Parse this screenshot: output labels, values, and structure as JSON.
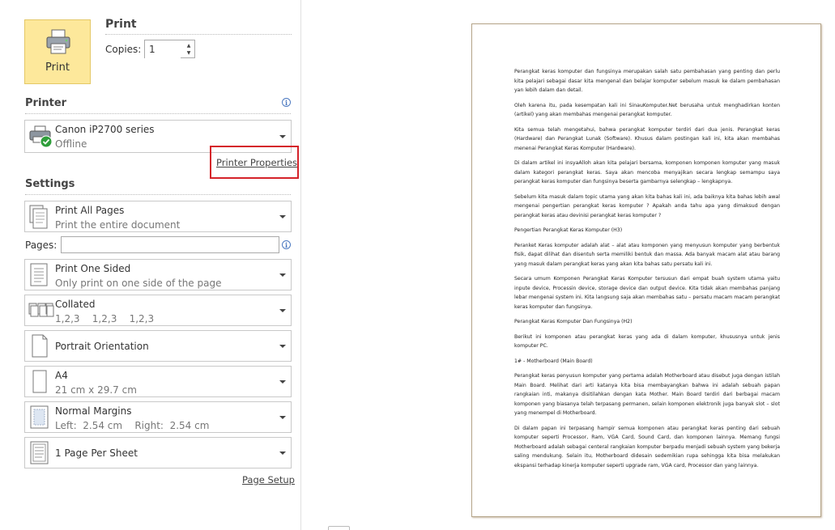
{
  "print": {
    "button_label": "Print",
    "title": "Print",
    "copies_label": "Copies:",
    "copies_value": "1"
  },
  "printer": {
    "heading": "Printer",
    "name": "Canon iP2700 series",
    "status": "Offline",
    "properties_link": "Printer Properties"
  },
  "settings": {
    "heading": "Settings",
    "pages_label": "Pages:",
    "pages_value": "",
    "items": [
      {
        "title": "Print All Pages",
        "subtitle": "Print the entire document",
        "icon": "pages-icon"
      },
      {
        "title": "Print One Sided",
        "subtitle": "Only print on one side of the page",
        "icon": "one-sided-icon"
      },
      {
        "title": "Collated",
        "subtitle": "1,2,3    1,2,3    1,2,3",
        "icon": "collated-icon"
      },
      {
        "title": "Portrait Orientation",
        "subtitle": "",
        "icon": "portrait-icon"
      },
      {
        "title": "A4",
        "subtitle": "21 cm x 29.7 cm",
        "icon": "paper-size-icon"
      },
      {
        "title": "Normal Margins",
        "subtitle": "Left:  2.54 cm    Right:  2.54 cm",
        "icon": "margins-icon"
      },
      {
        "title": "1 Page Per Sheet",
        "subtitle": "",
        "icon": "pages-per-sheet-icon"
      }
    ],
    "page_setup_link": "Page Setup"
  },
  "preview": {
    "paragraphs": [
      "Perangkat keras komputer dan fungsinya merupakan salah satu pembahasan yang penting dan perlu kita pelajari sebagai dasar kita mengenal dan belajar komputer sebelum masuk ke dalam pembahasan yan lebih dalam dan detail.",
      "Oleh karena itu, pada kesempatan kali ini SinauKomputer.Net berusaha untuk menghadirkan konten (artikel) yang akan membahas mengenai perangkat komputer.",
      "Kita semua telah mengetahui, bahwa perangkat komputer terdiri dari dua jenis. Perangkat keras (Hardware) dan Perangkat Lunak (Software). Khusus dalam postingan kali ini, kita akan membahas menenai Perangkat Keras Komputer (Hardware).",
      "Di dalam artikel ini insyaAlloh akan kita pelajari bersama, komponen komponen komputer yang masuk dalam kategori perangkat keras. Saya akan mencoba menyajikan secara lengkap semampu saya perangkat keras komputer dan fungsinya beserta gambarnya selengkap – lengkapnya.",
      "Sebelum kita masuk dalam topic utama yang akan kita bahas kali ini, ada baiknya kita bahas lebih awal mengenai pengertian perangkat keras komputer ? Apakah anda tahu apa yang dimaksud dengan perangkat keras atau devinisi perangkat keras komputer ?",
      "Pengertian Perangkat Keras Komputer (H3)",
      "Peranket Keras komputer adalah alat – alat atau komponen yang menyusun komputer yang berbentuk fisik, dapat dilihat dan disentuh serta memiliki bentuk dan massa. Ada banyak macam alat atau barang yang masuk dalam perangkat keras yang akan kita bahas satu persatu kali ini.",
      "Secara umum Komponen Perangkat Keras Komputer tersusun dari empat buah system utama yaitu inpute device, Processin device, storage device dan output device. Kita tidak akan membahas panjang lebar mengenai system ini. Kita langsung saja akan membahas satu – persatu macam macam perangkat keras komputer dan fungsinya.",
      "Perangkat Keras Komputer Dan Fungsinya (H2)",
      "Berikut ini komponen atau perangkat keras yang ada di dalam komputer, khususnya untuk jenis komputer PC.",
      "1# - Motherboard (Main Board)",
      "Perangkat keras penyusun komputer yang pertama adalah Motherboard atau disebut juga dengan istilah Main Board.  Melihat dari arti katanya kita bisa membayangkan bahwa ini adalah sebuah papan rangkaian inti, makanya disitilahkan dengan kata Mother. Main Board terdiri dari berbagai macam komponen yang biasanya telah terpasang permanen, selain komponen elektronik juga banyak slot – slot yang menempel di Motherboard.",
      "Di dalam papan ini terpasang hampir semua komponen atau perangkat keras penting dari sebuah komputer seperti Processor, Ram, VGA Card, Sound Card,  dan komponen lainnya. Memang fungsi Motherboard adalah sebagai centeral rangkaian komputer berpadu menjadi sebuah system yang bekerja saling mendukung. Selain itu, Motherboard didesain sedemikian rupa sehingga kita bisa melakukan ekspansi terhadap kinerja komputer seperti upgrade ram, VGA card, Processor dan yang lainnya."
    ]
  },
  "colors": {
    "print_button_bg": "#fde89b",
    "highlight_border": "#d5232a",
    "info_icon": "#4a78c0",
    "status_ok": "#2e9e3a"
  }
}
